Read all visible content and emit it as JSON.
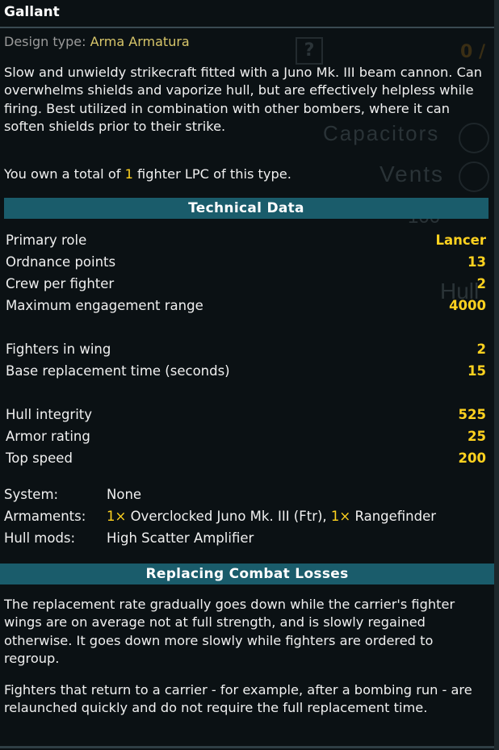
{
  "title": "Gallant",
  "design": {
    "label": "Design type:",
    "value": "Arma Armatura"
  },
  "description": "Slow and unwieldy strikecraft fitted with a Juno Mk. III beam cannon. Can overwhelms shields and vaporize hull, but are effectively helpless while firing. Best utilized in combination with other bombers, where it can soften shields prior to their strike.",
  "ownership": {
    "prefix": "You own a total of ",
    "count": "1",
    "suffix": " fighter LPC of this type."
  },
  "technical": {
    "header": "Technical Data",
    "rows": [
      {
        "label": "Primary role",
        "value": "Lancer"
      },
      {
        "label": "Ordnance points",
        "value": "13"
      },
      {
        "label": "Crew per fighter",
        "value": "2"
      },
      {
        "label": "Maximum engagement range",
        "value": "4000"
      },
      {
        "label": "Fighters in wing",
        "value": "2"
      },
      {
        "label": "Base replacement time (seconds)",
        "value": "15"
      },
      {
        "label": "Hull integrity",
        "value": "525"
      },
      {
        "label": "Armor rating",
        "value": "25"
      },
      {
        "label": "Top speed",
        "value": "200"
      }
    ]
  },
  "system": {
    "label": "System:",
    "value": "None"
  },
  "armaments": {
    "label": "Armaments:",
    "qty1": "1×",
    "item1": " Overclocked Juno Mk. III (Ftr), ",
    "qty2": "1×",
    "item2": " Rangefinder"
  },
  "hullmods": {
    "label": "Hull mods:",
    "value": "High Scatter Amplifier"
  },
  "losses": {
    "header": "Replacing Combat Losses",
    "para1": "The replacement rate gradually goes down while the carrier's fighter wings are on average not at full strength, and is slowly regained otherwise. It goes down more slowly while fighters are ordered to regroup.",
    "para2": "Fighters that return to a carrier - for example, after a bombing run - are relaunched quickly and do not require the full replacement time."
  },
  "background_ui": {
    "capacitors": "Capacitors",
    "vents": "Vents",
    "hull": "Hull",
    "flux": "100",
    "help": "?"
  },
  "colors": {
    "accent": "#ffd21f",
    "header_bg": "#1a5c6b",
    "design_value": "#d8c66a"
  }
}
